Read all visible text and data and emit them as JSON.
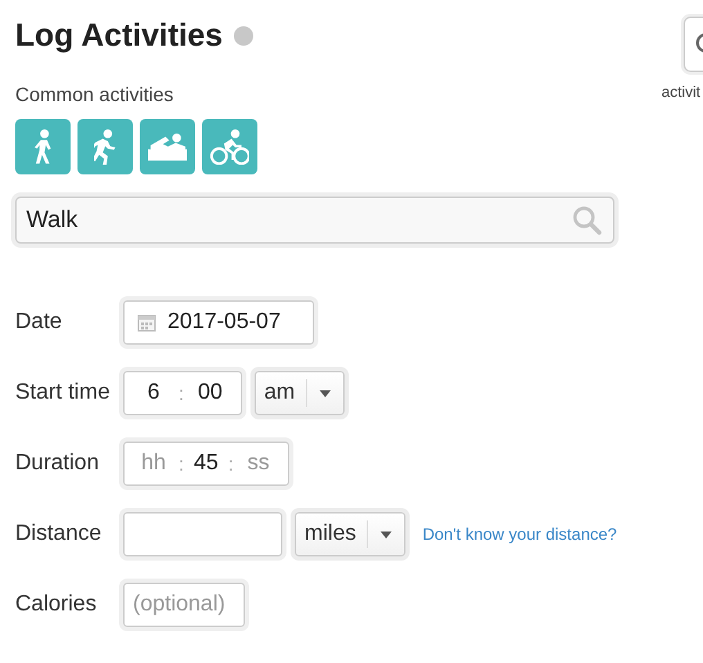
{
  "title": "Log Activities",
  "side_button": {
    "label": "activit"
  },
  "common_label": "Common activities",
  "activities": [
    {
      "kind": "walk"
    },
    {
      "kind": "run"
    },
    {
      "kind": "swim"
    },
    {
      "kind": "bike"
    }
  ],
  "search": {
    "value": "Walk"
  },
  "fields": [
    {
      "kind": "date",
      "label": "Date",
      "value": "2017-05-07"
    },
    {
      "kind": "time",
      "label": "Start time",
      "parts": [
        {
          "value": "6"
        },
        {
          "value": "00"
        }
      ],
      "separator": ":",
      "select": "am"
    },
    {
      "kind": "duration",
      "label": "Duration",
      "parts": [
        {
          "placeholder": "hh"
        },
        {
          "value": "45"
        },
        {
          "placeholder": "ss"
        }
      ],
      "separator": ":"
    },
    {
      "kind": "distance",
      "label": "Distance",
      "select": "miles",
      "link": "Don't know your distance?"
    },
    {
      "kind": "calories",
      "label": "Calories",
      "placeholder": "(optional)"
    }
  ]
}
